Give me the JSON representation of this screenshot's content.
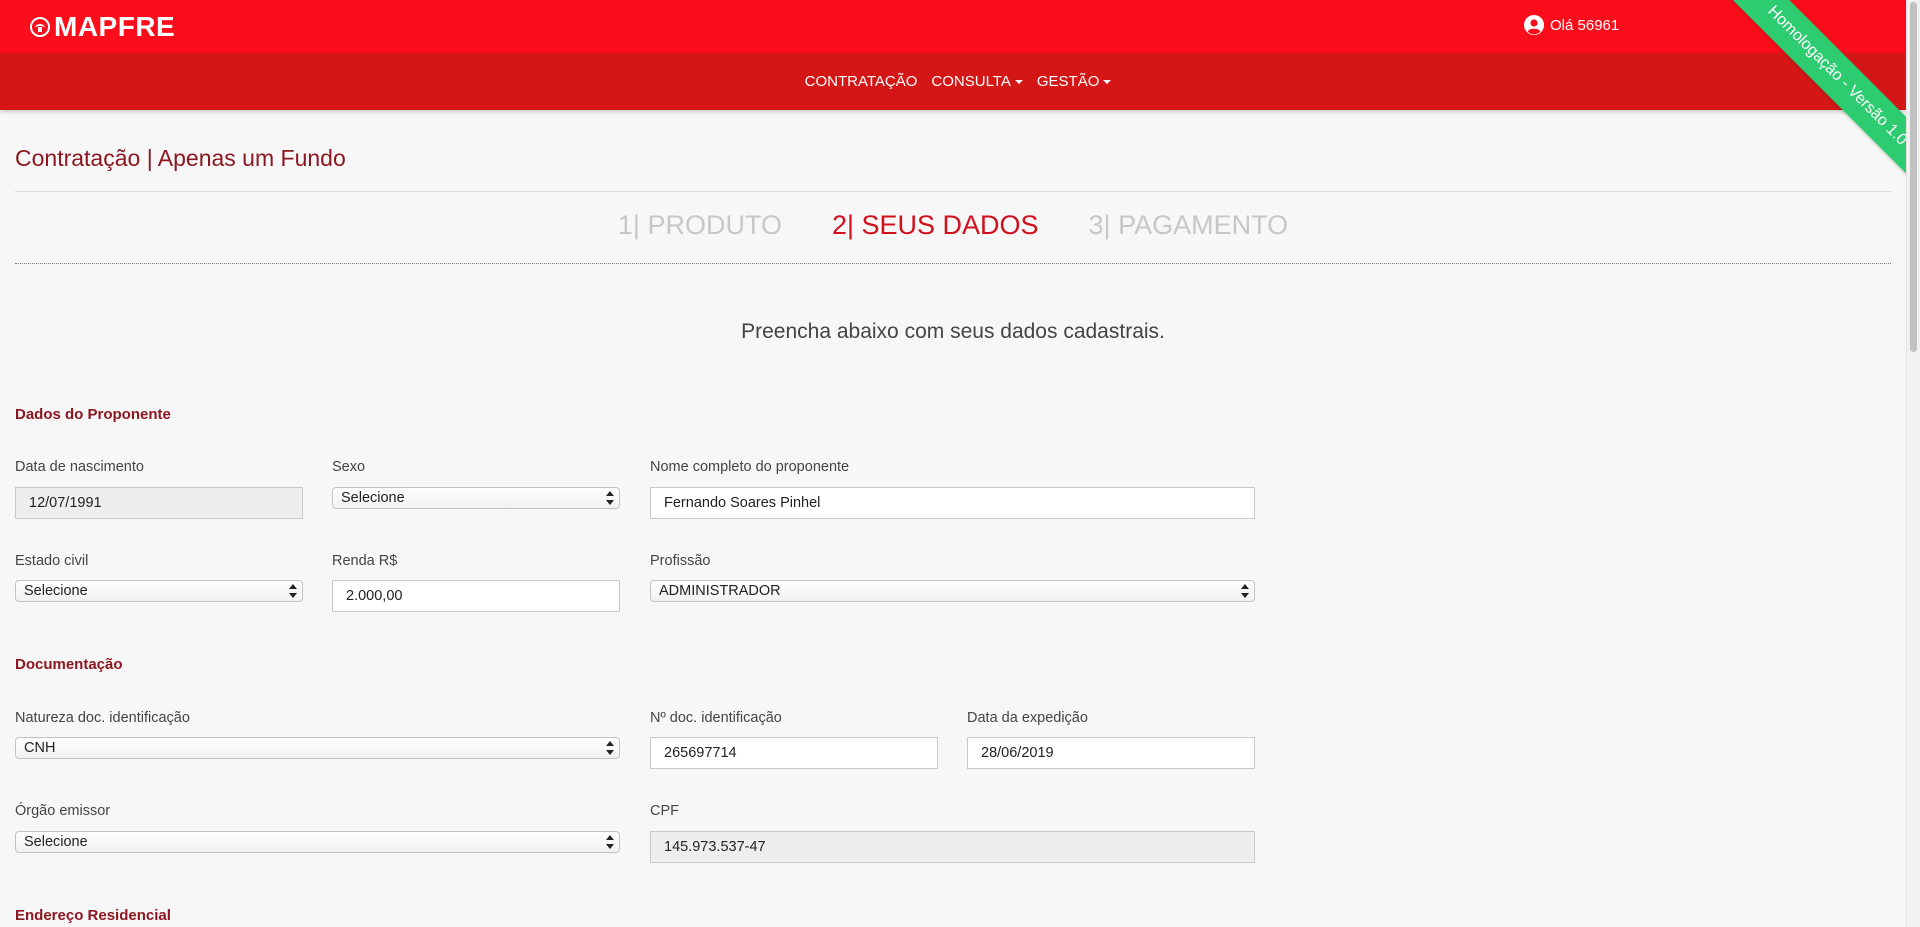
{
  "header": {
    "brand": "MAPFRE",
    "greeting": "Olá 56961",
    "ribbon": "Homologação - Versão 1.0"
  },
  "nav": {
    "items": [
      {
        "label": "CONTRATAÇÃO",
        "dropdown": false
      },
      {
        "label": "CONSULTA",
        "dropdown": true
      },
      {
        "label": "GESTÃO",
        "dropdown": true
      }
    ]
  },
  "page": {
    "title": "Contratação | Apenas um Fundo",
    "intro": "Preencha abaixo com seus dados cadastrais."
  },
  "steps": [
    {
      "label": "1| PRODUTO",
      "active": false
    },
    {
      "label": "2| SEUS DADOS",
      "active": true
    },
    {
      "label": "3| PAGAMENTO",
      "active": false
    }
  ],
  "sections": {
    "proponente": "Dados do Proponente",
    "documentacao": "Documentação",
    "endereco": "Endereço Residencial"
  },
  "form": {
    "data_nascimento": {
      "label": "Data de nascimento",
      "value": "12/07/1991"
    },
    "sexo": {
      "label": "Sexo",
      "value": "Selecione"
    },
    "nome": {
      "label": "Nome completo do proponente",
      "value": "Fernando Soares Pinhel"
    },
    "estado_civil": {
      "label": "Estado civil",
      "value": "Selecione"
    },
    "renda": {
      "label": "Renda R$",
      "value": "2.000,00"
    },
    "profissao": {
      "label": "Profissão",
      "value": "ADMINISTRADOR"
    },
    "natureza_doc": {
      "label": "Natureza doc. identificação",
      "value": "CNH"
    },
    "num_doc": {
      "label": "Nº doc. identificação",
      "value": "265697714"
    },
    "data_expedicao": {
      "label": "Data da expedição",
      "value": "28/06/2019"
    },
    "orgao_emissor": {
      "label": "Órgão emissor",
      "value": "Selecione"
    },
    "cpf": {
      "label": "CPF",
      "value": "145.973.537-47"
    }
  },
  "colors": {
    "header_red": "#fb0d1b",
    "nav_red": "#d51616",
    "title_red": "#8c1720",
    "active_step": "#d0101d",
    "ribbon_green": "#2ecc71"
  }
}
